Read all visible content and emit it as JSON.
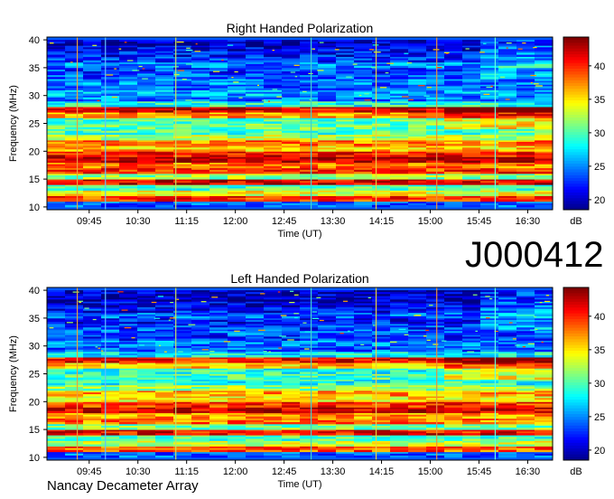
{
  "observation_id": "J000412",
  "footer": "Nancay Decameter Array",
  "chart_data": [
    {
      "type": "heatmap",
      "title": "Right Handed Polarization",
      "xlabel": "Time (UT)",
      "ylabel": "Frequency (MHz)",
      "x_ticks": [
        "09:45",
        "10:30",
        "11:15",
        "12:00",
        "12:45",
        "13:30",
        "14:15",
        "15:00",
        "15:45",
        "16:30"
      ],
      "x_tick_minutes": [
        585,
        630,
        675,
        720,
        765,
        810,
        855,
        900,
        945,
        990
      ],
      "xlim_minutes": [
        546,
        1013
      ],
      "ylim": [
        9.5,
        40.5
      ],
      "y_ticks": [
        10,
        15,
        20,
        25,
        30,
        35,
        40
      ],
      "colorbar": {
        "label": "dB",
        "ticks": [
          20,
          25,
          30,
          35,
          40
        ],
        "range": [
          18.5,
          44.3
        ]
      },
      "bands": [
        {
          "f": [
            10,
            11
          ],
          "db": 24
        },
        {
          "f": [
            11,
            12
          ],
          "db": 40
        },
        {
          "f": [
            12,
            13
          ],
          "db": 34
        },
        {
          "f": [
            13,
            14
          ],
          "db": 30
        },
        {
          "f": [
            14,
            15
          ],
          "db": 42
        },
        {
          "f": [
            15,
            16
          ],
          "db": 32
        },
        {
          "f": [
            16,
            17
          ],
          "db": 40
        },
        {
          "f": [
            17,
            18
          ],
          "db": 38
        },
        {
          "f": [
            18,
            19
          ],
          "db": 43
        },
        {
          "f": [
            19,
            20
          ],
          "db": 41
        },
        {
          "f": [
            20,
            21
          ],
          "db": 36
        },
        {
          "f": [
            21,
            22
          ],
          "db": 38
        },
        {
          "f": [
            22,
            23
          ],
          "db": 33
        },
        {
          "f": [
            23,
            24
          ],
          "db": 30
        },
        {
          "f": [
            24,
            25
          ],
          "db": 31
        },
        {
          "f": [
            25,
            26
          ],
          "db": 30
        },
        {
          "f": [
            26,
            27
          ],
          "db": 37
        },
        {
          "f": [
            27,
            28
          ],
          "db": 42
        },
        {
          "f": [
            28,
            29
          ],
          "db": 29
        },
        {
          "f": [
            29,
            30
          ],
          "db": 25
        },
        {
          "f": [
            30,
            31
          ],
          "db": 26
        },
        {
          "f": [
            31,
            32
          ],
          "db": 24
        },
        {
          "f": [
            32,
            33
          ],
          "db": 25
        },
        {
          "f": [
            33,
            34
          ],
          "db": 24
        },
        {
          "f": [
            34,
            35
          ],
          "db": 23
        },
        {
          "f": [
            35,
            36
          ],
          "db": 25
        },
        {
          "f": [
            36,
            37
          ],
          "db": 23
        },
        {
          "f": [
            37,
            38
          ],
          "db": 22
        },
        {
          "f": [
            38,
            39
          ],
          "db": 21
        },
        {
          "f": [
            39,
            40
          ],
          "db": 20
        }
      ],
      "vertical_lines": [
        {
          "minute": 574,
          "color": "#e8a040"
        },
        {
          "minute": 600,
          "color": "#60c0ff"
        },
        {
          "minute": 665,
          "color": "#c8e060"
        },
        {
          "minute": 790,
          "color": "#40d0d0"
        },
        {
          "minute": 850,
          "color": "#e8d040"
        },
        {
          "minute": 906,
          "color": "#e89040"
        },
        {
          "minute": 960,
          "color": "#60ffe0"
        }
      ]
    },
    {
      "type": "heatmap",
      "title": "Left Handed Polarization",
      "xlabel": "Time (UT)",
      "ylabel": "Frequency (MHz)",
      "x_ticks": [
        "09:45",
        "10:30",
        "11:15",
        "12:00",
        "12:45",
        "13:30",
        "14:15",
        "15:00",
        "15:45",
        "16:30"
      ],
      "x_tick_minutes": [
        585,
        630,
        675,
        720,
        765,
        810,
        855,
        900,
        945,
        990
      ],
      "xlim_minutes": [
        546,
        1013
      ],
      "ylim": [
        9.5,
        40.5
      ],
      "y_ticks": [
        10,
        15,
        20,
        25,
        30,
        35,
        40
      ],
      "colorbar": {
        "label": "dB",
        "ticks": [
          20,
          25,
          30,
          35,
          40
        ],
        "range": [
          18.5,
          44.3
        ]
      },
      "bands": [
        {
          "f": [
            10,
            11
          ],
          "db": 24
        },
        {
          "f": [
            11,
            12
          ],
          "db": 39
        },
        {
          "f": [
            12,
            13
          ],
          "db": 33
        },
        {
          "f": [
            13,
            14
          ],
          "db": 30
        },
        {
          "f": [
            14,
            15
          ],
          "db": 41
        },
        {
          "f": [
            15,
            16
          ],
          "db": 31
        },
        {
          "f": [
            16,
            17
          ],
          "db": 38
        },
        {
          "f": [
            17,
            18
          ],
          "db": 37
        },
        {
          "f": [
            18,
            19
          ],
          "db": 42
        },
        {
          "f": [
            19,
            20
          ],
          "db": 40
        },
        {
          "f": [
            20,
            21
          ],
          "db": 35
        },
        {
          "f": [
            21,
            22
          ],
          "db": 37
        },
        {
          "f": [
            22,
            23
          ],
          "db": 32
        },
        {
          "f": [
            23,
            24
          ],
          "db": 29
        },
        {
          "f": [
            24,
            25
          ],
          "db": 30
        },
        {
          "f": [
            25,
            26
          ],
          "db": 29
        },
        {
          "f": [
            26,
            27
          ],
          "db": 36
        },
        {
          "f": [
            27,
            28
          ],
          "db": 41
        },
        {
          "f": [
            28,
            29
          ],
          "db": 28
        },
        {
          "f": [
            29,
            30
          ],
          "db": 24
        },
        {
          "f": [
            30,
            31
          ],
          "db": 25
        },
        {
          "f": [
            31,
            32
          ],
          "db": 23
        },
        {
          "f": [
            32,
            33
          ],
          "db": 24
        },
        {
          "f": [
            33,
            34
          ],
          "db": 23
        },
        {
          "f": [
            34,
            35
          ],
          "db": 22
        },
        {
          "f": [
            35,
            36
          ],
          "db": 24
        },
        {
          "f": [
            36,
            37
          ],
          "db": 22
        },
        {
          "f": [
            37,
            38
          ],
          "db": 21
        },
        {
          "f": [
            38,
            39
          ],
          "db": 20
        },
        {
          "f": [
            39,
            40
          ],
          "db": 20
        }
      ],
      "vertical_lines": [
        {
          "minute": 574,
          "color": "#e8a040"
        },
        {
          "minute": 600,
          "color": "#60c0ff"
        },
        {
          "minute": 665,
          "color": "#c8e060"
        },
        {
          "minute": 790,
          "color": "#40d0d0"
        },
        {
          "minute": 850,
          "color": "#e8d040"
        },
        {
          "minute": 906,
          "color": "#e89040"
        },
        {
          "minute": 960,
          "color": "#60ffe0"
        }
      ]
    }
  ]
}
